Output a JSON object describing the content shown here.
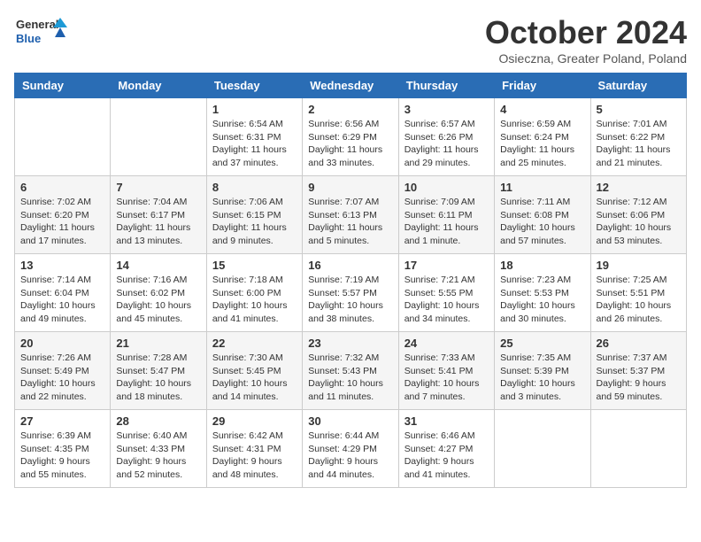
{
  "logo": {
    "text_general": "General",
    "text_blue": "Blue"
  },
  "title": "October 2024",
  "subtitle": "Osieczna, Greater Poland, Poland",
  "weekdays": [
    "Sunday",
    "Monday",
    "Tuesday",
    "Wednesday",
    "Thursday",
    "Friday",
    "Saturday"
  ],
  "weeks": [
    [
      {
        "day": "",
        "info": ""
      },
      {
        "day": "",
        "info": ""
      },
      {
        "day": "1",
        "info": "Sunrise: 6:54 AM\nSunset: 6:31 PM\nDaylight: 11 hours and 37 minutes."
      },
      {
        "day": "2",
        "info": "Sunrise: 6:56 AM\nSunset: 6:29 PM\nDaylight: 11 hours and 33 minutes."
      },
      {
        "day": "3",
        "info": "Sunrise: 6:57 AM\nSunset: 6:26 PM\nDaylight: 11 hours and 29 minutes."
      },
      {
        "day": "4",
        "info": "Sunrise: 6:59 AM\nSunset: 6:24 PM\nDaylight: 11 hours and 25 minutes."
      },
      {
        "day": "5",
        "info": "Sunrise: 7:01 AM\nSunset: 6:22 PM\nDaylight: 11 hours and 21 minutes."
      }
    ],
    [
      {
        "day": "6",
        "info": "Sunrise: 7:02 AM\nSunset: 6:20 PM\nDaylight: 11 hours and 17 minutes."
      },
      {
        "day": "7",
        "info": "Sunrise: 7:04 AM\nSunset: 6:17 PM\nDaylight: 11 hours and 13 minutes."
      },
      {
        "day": "8",
        "info": "Sunrise: 7:06 AM\nSunset: 6:15 PM\nDaylight: 11 hours and 9 minutes."
      },
      {
        "day": "9",
        "info": "Sunrise: 7:07 AM\nSunset: 6:13 PM\nDaylight: 11 hours and 5 minutes."
      },
      {
        "day": "10",
        "info": "Sunrise: 7:09 AM\nSunset: 6:11 PM\nDaylight: 11 hours and 1 minute."
      },
      {
        "day": "11",
        "info": "Sunrise: 7:11 AM\nSunset: 6:08 PM\nDaylight: 10 hours and 57 minutes."
      },
      {
        "day": "12",
        "info": "Sunrise: 7:12 AM\nSunset: 6:06 PM\nDaylight: 10 hours and 53 minutes."
      }
    ],
    [
      {
        "day": "13",
        "info": "Sunrise: 7:14 AM\nSunset: 6:04 PM\nDaylight: 10 hours and 49 minutes."
      },
      {
        "day": "14",
        "info": "Sunrise: 7:16 AM\nSunset: 6:02 PM\nDaylight: 10 hours and 45 minutes."
      },
      {
        "day": "15",
        "info": "Sunrise: 7:18 AM\nSunset: 6:00 PM\nDaylight: 10 hours and 41 minutes."
      },
      {
        "day": "16",
        "info": "Sunrise: 7:19 AM\nSunset: 5:57 PM\nDaylight: 10 hours and 38 minutes."
      },
      {
        "day": "17",
        "info": "Sunrise: 7:21 AM\nSunset: 5:55 PM\nDaylight: 10 hours and 34 minutes."
      },
      {
        "day": "18",
        "info": "Sunrise: 7:23 AM\nSunset: 5:53 PM\nDaylight: 10 hours and 30 minutes."
      },
      {
        "day": "19",
        "info": "Sunrise: 7:25 AM\nSunset: 5:51 PM\nDaylight: 10 hours and 26 minutes."
      }
    ],
    [
      {
        "day": "20",
        "info": "Sunrise: 7:26 AM\nSunset: 5:49 PM\nDaylight: 10 hours and 22 minutes."
      },
      {
        "day": "21",
        "info": "Sunrise: 7:28 AM\nSunset: 5:47 PM\nDaylight: 10 hours and 18 minutes."
      },
      {
        "day": "22",
        "info": "Sunrise: 7:30 AM\nSunset: 5:45 PM\nDaylight: 10 hours and 14 minutes."
      },
      {
        "day": "23",
        "info": "Sunrise: 7:32 AM\nSunset: 5:43 PM\nDaylight: 10 hours and 11 minutes."
      },
      {
        "day": "24",
        "info": "Sunrise: 7:33 AM\nSunset: 5:41 PM\nDaylight: 10 hours and 7 minutes."
      },
      {
        "day": "25",
        "info": "Sunrise: 7:35 AM\nSunset: 5:39 PM\nDaylight: 10 hours and 3 minutes."
      },
      {
        "day": "26",
        "info": "Sunrise: 7:37 AM\nSunset: 5:37 PM\nDaylight: 9 hours and 59 minutes."
      }
    ],
    [
      {
        "day": "27",
        "info": "Sunrise: 6:39 AM\nSunset: 4:35 PM\nDaylight: 9 hours and 55 minutes."
      },
      {
        "day": "28",
        "info": "Sunrise: 6:40 AM\nSunset: 4:33 PM\nDaylight: 9 hours and 52 minutes."
      },
      {
        "day": "29",
        "info": "Sunrise: 6:42 AM\nSunset: 4:31 PM\nDaylight: 9 hours and 48 minutes."
      },
      {
        "day": "30",
        "info": "Sunrise: 6:44 AM\nSunset: 4:29 PM\nDaylight: 9 hours and 44 minutes."
      },
      {
        "day": "31",
        "info": "Sunrise: 6:46 AM\nSunset: 4:27 PM\nDaylight: 9 hours and 41 minutes."
      },
      {
        "day": "",
        "info": ""
      },
      {
        "day": "",
        "info": ""
      }
    ]
  ]
}
